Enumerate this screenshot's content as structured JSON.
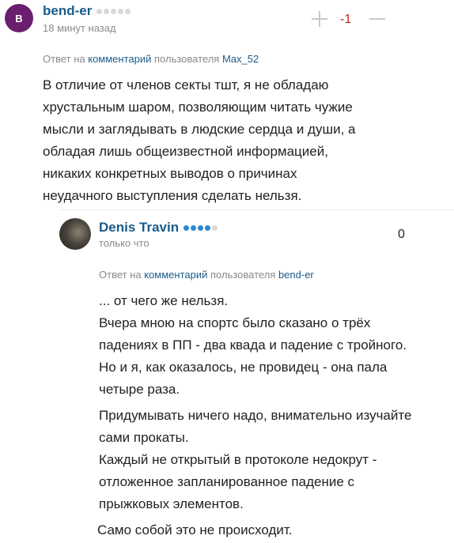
{
  "comment1": {
    "avatar_letter": "B",
    "username": "bend-er",
    "rating_dots": [
      false,
      false,
      false,
      false,
      false
    ],
    "time": "18 минут назад",
    "score": "-1",
    "reply_prefix": "Ответ на",
    "reply_link": "комментарий",
    "reply_mid": "пользователя",
    "reply_user": "Max_52",
    "lines": [
      "В отличие от членов секты тшт, я не обладаю",
      "хрустальным шаром, позволяющим читать чужие",
      "мысли и заглядывать в людские сердца и души, а",
      "обладая лишь общеизвестной информацией,",
      "никаких конкретных выводов о причинах",
      "неудачного выступления сделать нельзя."
    ]
  },
  "comment2": {
    "username": "Denis Travin",
    "rating_dots": [
      true,
      true,
      true,
      true,
      false
    ],
    "time": "только что",
    "score": "0",
    "reply_prefix": "Ответ на",
    "reply_link": "комментарий",
    "reply_mid": "пользователя",
    "reply_user": "bend-er",
    "para1": [
      "... от чего же нельзя.",
      "Вчера мною на спортс было сказано о трёх",
      "падениях в ПП - два квада и падение с тройного.",
      "Но и я, как оказалось, не провидец - она пала",
      "четыре раза."
    ],
    "para2": [
      "Придумывать ничего надо, внимательно изучайте",
      "сами прокаты.",
      "Каждый не открытый в протоколе недокрут -",
      "отложенное запланированное падение с",
      "прыжковых элементов."
    ],
    "para3": "Само собой это не происходит."
  },
  "colors": {
    "accent": "#1b5c8a",
    "avatar_bg": "#6a1e6e",
    "negative_score": "#d0201e",
    "dot_active": "#2a8ad0",
    "dot_inactive": "#d9d9d9"
  },
  "icons": [
    "plus-icon",
    "minus-icon"
  ]
}
